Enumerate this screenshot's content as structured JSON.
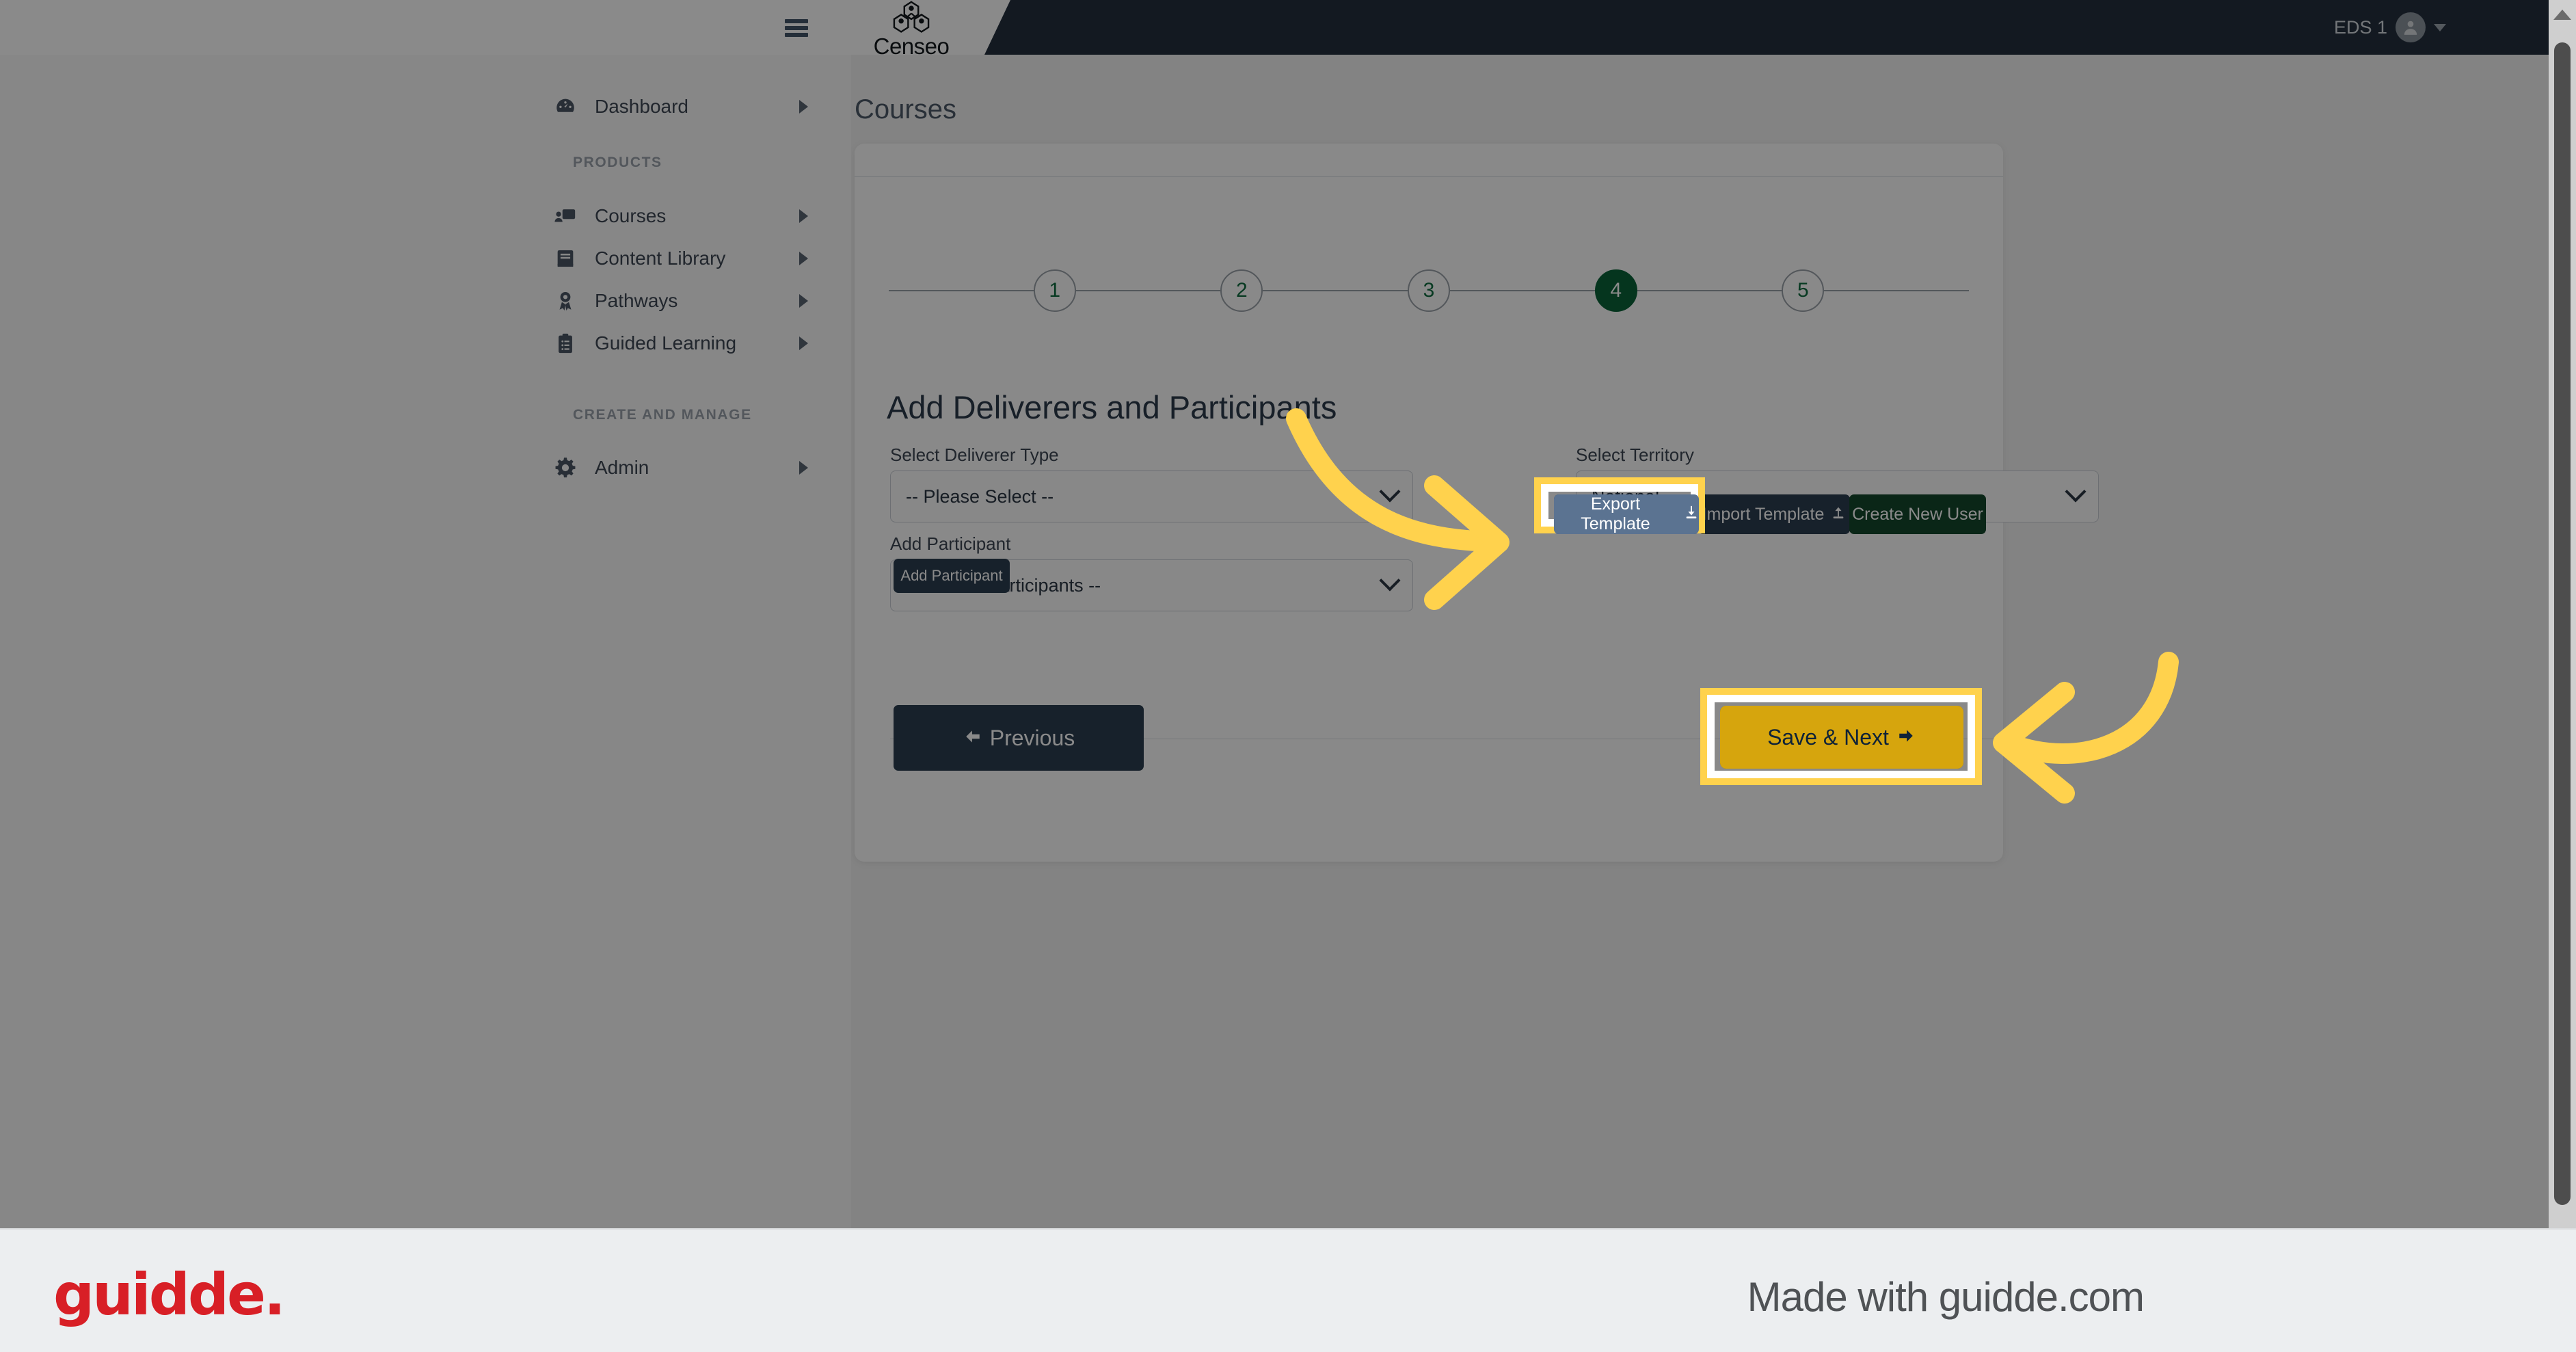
{
  "topbar": {
    "menu_icon": "hamburger-icon",
    "brand_name": "Censeo",
    "brand_logo_icon": "censeo-hexagon-logo-icon",
    "user_name": "EDS 1",
    "user_avatar_icon": "user-avatar-icon",
    "user_caret_icon": "chevron-down-icon"
  },
  "sidebar": {
    "items": [
      {
        "label": "Dashboard",
        "icon": "dashboard-gauge-icon"
      },
      {
        "label": "Courses",
        "icon": "courses-presentation-icon"
      },
      {
        "label": "Content Library",
        "icon": "book-icon"
      },
      {
        "label": "Pathways",
        "icon": "award-ribbon-icon"
      },
      {
        "label": "Guided Learning",
        "icon": "clipboard-list-icon"
      },
      {
        "label": "Admin",
        "icon": "gear-icon"
      }
    ],
    "sections": [
      {
        "label": "PRODUCTS"
      },
      {
        "label": "CREATE AND MANAGE"
      }
    ]
  },
  "main": {
    "page_title": "Courses",
    "stepper": {
      "steps": [
        "1",
        "2",
        "3",
        "4",
        "5"
      ],
      "active_step": "4",
      "active_color": "#0a6238",
      "inactive_text_color": "#0f6b3f"
    },
    "form": {
      "heading": "Add Deliverers and Participants",
      "deliverer_type_label": "Select Deliverer Type",
      "deliverer_type_value": "-- Please Select --",
      "territory_label": "Select Territory",
      "territory_value": "National",
      "add_participant_label": "Add Participant",
      "participant_search_value": "-- Search Participants --",
      "add_participant_button": "Add Participant"
    },
    "buttons": {
      "export_template": "Export Template",
      "export_template_icon": "download-icon",
      "import_template": "Import Template",
      "import_template_icon": "upload-icon",
      "create_new_user": "Create New User",
      "previous": "Previous",
      "previous_icon": "arrow-left-icon",
      "save_next": "Save & Next",
      "save_next_icon": "arrow-right-icon"
    }
  },
  "annotations": {
    "highlight_color": "#ffd24d",
    "arrow_color": "#ffd24d",
    "highlighted_elements": [
      "export-template-button",
      "save-next-button"
    ]
  },
  "footer": {
    "logo_text": "guidde.",
    "logo_color": "#d81f26",
    "made_with": "Made with guidde.com"
  }
}
